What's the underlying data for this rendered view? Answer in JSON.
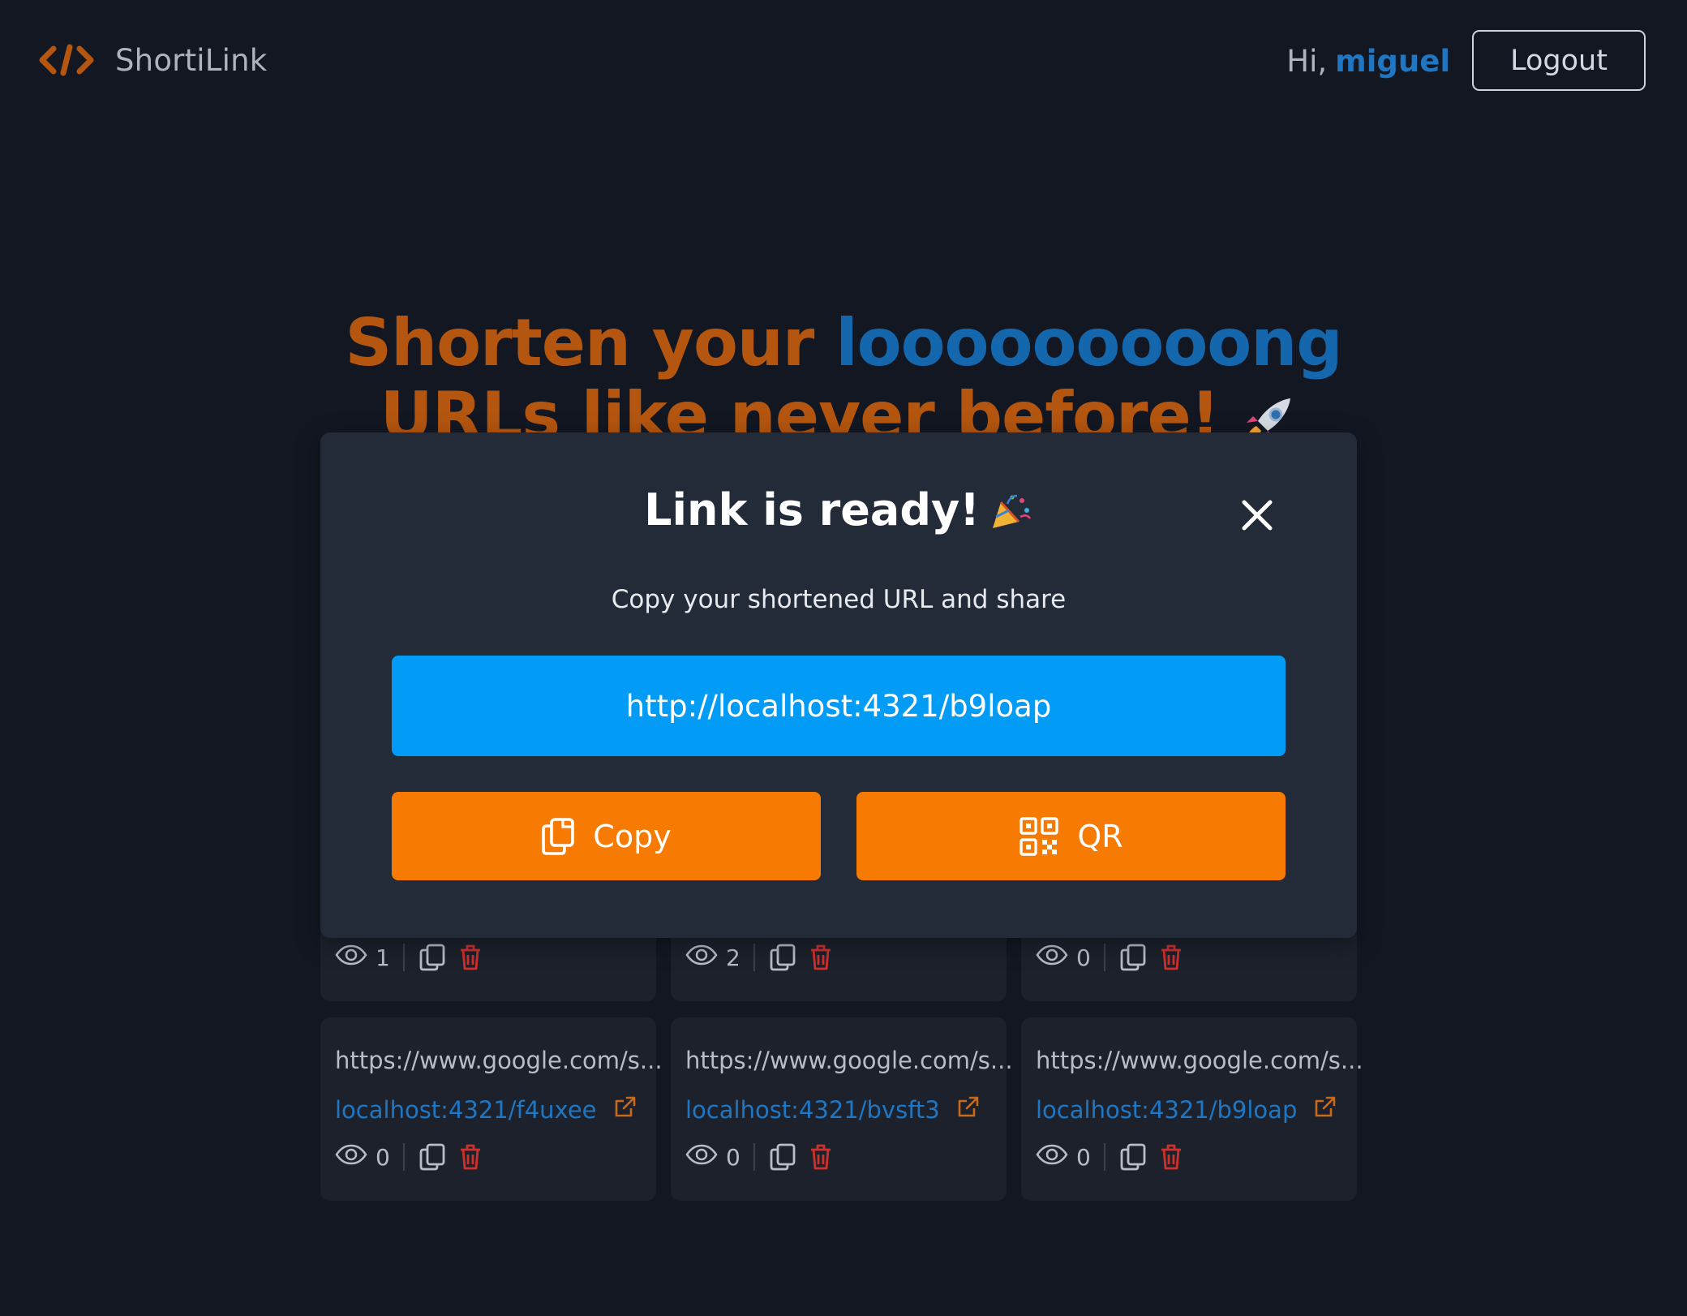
{
  "header": {
    "brand_name": "ShortiLink",
    "greeting": "Hi,",
    "username": "miguel",
    "logout_label": "Logout"
  },
  "hero": {
    "line1_prefix": "Shorten your",
    "line1_highlight": "looooooooong",
    "line2": "URLs like never before!"
  },
  "modal": {
    "title": "Link is ready!",
    "subtitle": "Copy your shortened URL and share",
    "short_url": "http://localhost:4321/b9loap",
    "copy_label": "Copy",
    "qr_label": "QR"
  },
  "cards_top": [
    {
      "clicks": "1"
    },
    {
      "clicks": "2"
    },
    {
      "clicks": "0"
    }
  ],
  "cards_bottom": [
    {
      "original": "https://www.google.com/s...",
      "short": "localhost:4321/f4uxee",
      "clicks": "0"
    },
    {
      "original": "https://www.google.com/s...",
      "short": "localhost:4321/bvsft3",
      "clicks": "0"
    },
    {
      "original": "https://www.google.com/s...",
      "short": "localhost:4321/b9loap",
      "clicks": "0"
    }
  ],
  "colors": {
    "background": "#121722",
    "brand_orange": "#b4560f",
    "brand_blue": "#1467ad",
    "link_blue": "#1f77c4",
    "url_box": "#029cf7",
    "action_orange": "#f77a02",
    "delete_red": "#d0312d"
  },
  "icons": {
    "brand": "code-brackets-icon",
    "rocket": "rocket-icon",
    "party": "party-popper-icon",
    "close": "close-icon",
    "copy": "copy-icon",
    "qr": "qr-code-icon",
    "views": "eye-icon",
    "delete": "trash-icon",
    "external": "external-link-icon"
  }
}
